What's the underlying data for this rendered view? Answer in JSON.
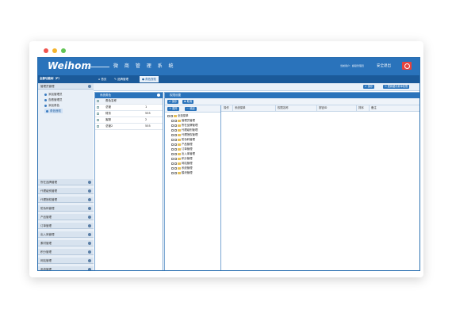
{
  "colors": {
    "window_dot_red": "#f0544f",
    "window_dot_yellow": "#f5b52e",
    "window_dot_green": "#62c454",
    "header_blue": "#2a73bb",
    "tabbar_blue": "#1b5a9a",
    "logout_red": "#e6433d"
  },
  "header": {
    "logo": "Weihom",
    "title": "微 商 管 理 系 统",
    "user_info": "当前用户：超级管理员",
    "logout": "安全退出",
    "logout_icon": "power-icon"
  },
  "left_panel": {
    "title": "全部功能树（P）",
    "active_group": "管理员管理",
    "sub_items": [
      {
        "label": "添加管理员",
        "icon": "user-icon"
      },
      {
        "label": "查看管理员",
        "icon": "user-icon"
      },
      {
        "label": "添加角色",
        "icon": "user-icon"
      },
      {
        "label": "角色授权",
        "icon": "user-icon",
        "active": true
      }
    ],
    "groups": [
      "所在品牌管理",
      "代理级别管理",
      "代理授权管理",
      "防伪码管理",
      "产品管理",
      "订单管理",
      "出入库管理",
      "素材管理",
      "积分管理",
      "网站管理",
      "系统管理",
      "模块管理"
    ]
  },
  "tabs": [
    {
      "label": "首页",
      "icon": "home-icon"
    },
    {
      "label": "品牌管理",
      "icon": "edit-icon"
    },
    {
      "label": "角色授权",
      "icon": "user-icon",
      "active": true
    }
  ],
  "toolbar": {
    "save_label": "保存",
    "update_cache_label": "更新缓存菜单权限"
  },
  "role_panel": {
    "title": "系统角色",
    "header": {
      "name": "角色名称",
      "num": ""
    },
    "rows": [
      {
        "name": "总管",
        "num": "1"
      },
      {
        "name": "财务",
        "num": "555"
      },
      {
        "name": "客服",
        "num": "2"
      },
      {
        "name": "总管2",
        "num": "555"
      }
    ]
  },
  "perm_panel": {
    "title": "权限设置",
    "buttons": {
      "save": "保存",
      "cancel": "取消"
    },
    "menu_buttons": {
      "expand": "展开",
      "collapse": "收起"
    },
    "tree_root": "全选菜单",
    "tree_items": [
      "管理员管理",
      "所在品牌管理",
      "代理级别管理",
      "代理授权管理",
      "防伪码管理",
      "产品管理",
      "订单管理",
      "出入库管理",
      "积分管理",
      "网站管理",
      "系统管理",
      "模块管理"
    ],
    "grid_columns": [
      "操作",
      "系统菜单",
      "权限名称",
      "按钮ID",
      "排序",
      "备注"
    ]
  }
}
